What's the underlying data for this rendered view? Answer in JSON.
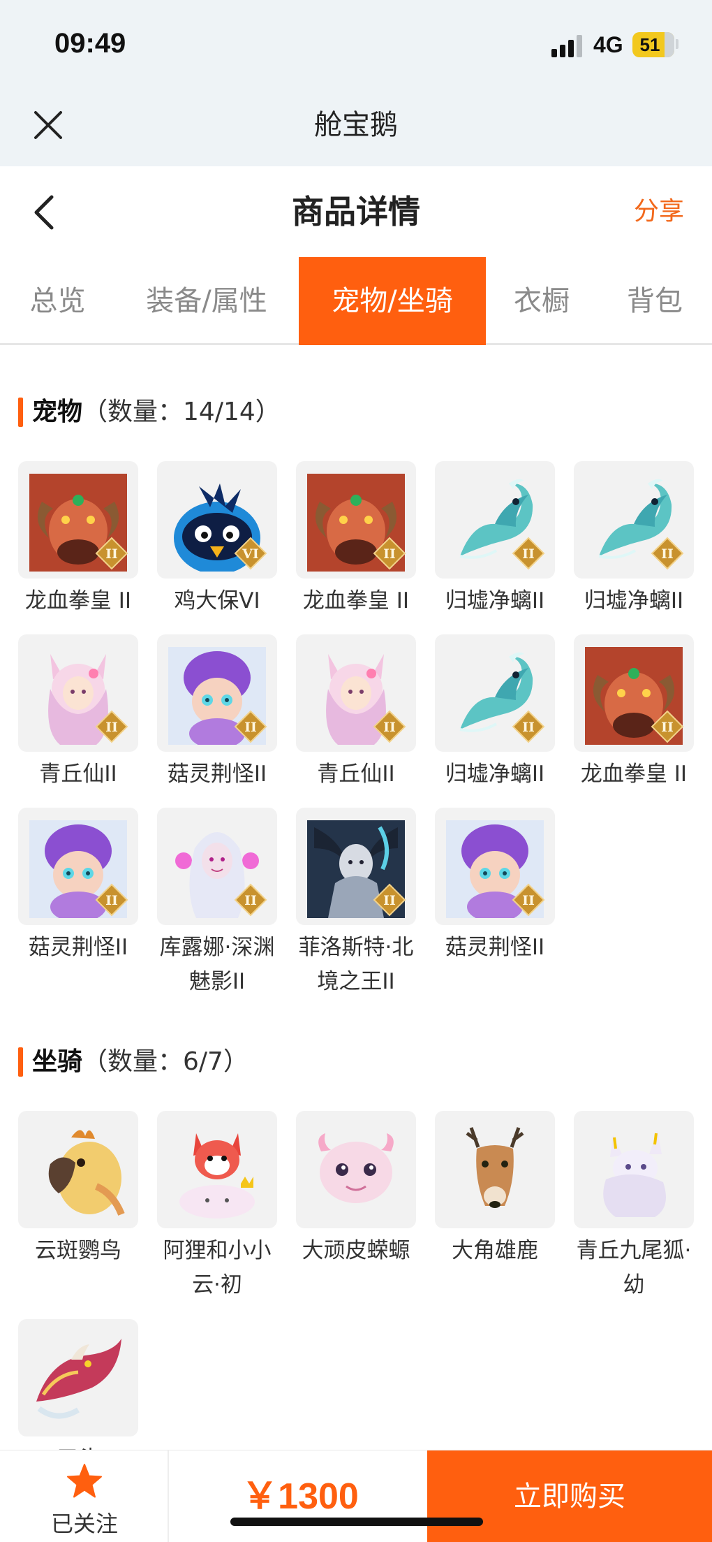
{
  "status_bar": {
    "time": "09:49",
    "network": "4G",
    "battery": "51"
  },
  "miniapp": {
    "title": "舱宝鹅"
  },
  "header": {
    "title": "商品详情",
    "share": "分享"
  },
  "tabs": [
    {
      "label": "总览",
      "active": false
    },
    {
      "label": "装备/属性",
      "active": false
    },
    {
      "label": "宠物/坐骑",
      "active": true
    },
    {
      "label": "衣橱",
      "active": false
    },
    {
      "label": "背包",
      "active": false
    }
  ],
  "pets": {
    "title": "宠物",
    "count_text": "（数量：14/14）",
    "items": [
      {
        "name": "龙血拳皇 II",
        "art": "dragon-fist",
        "badge": "II"
      },
      {
        "name": "鸡大保VI",
        "art": "blue-bird",
        "badge": "VI"
      },
      {
        "name": "龙血拳皇 II",
        "art": "dragon-fist",
        "badge": "II"
      },
      {
        "name": "归墟净螭II",
        "art": "sea-dragon",
        "badge": "II"
      },
      {
        "name": "归墟净螭II",
        "art": "sea-dragon",
        "badge": "II"
      },
      {
        "name": "青丘仙II",
        "art": "fox-fairy",
        "badge": "II"
      },
      {
        "name": "菇灵荆怪II",
        "art": "mushroom-sprite",
        "badge": "II"
      },
      {
        "name": "青丘仙II",
        "art": "fox-fairy",
        "badge": "II"
      },
      {
        "name": "归墟净螭II",
        "art": "sea-dragon",
        "badge": "II"
      },
      {
        "name": "龙血拳皇 II",
        "art": "dragon-fist",
        "badge": "II"
      },
      {
        "name": "菇灵荆怪II",
        "art": "mushroom-sprite",
        "badge": "II"
      },
      {
        "name": "库露娜·深渊魅影II",
        "art": "white-girl",
        "badge": "II"
      },
      {
        "name": "菲洛斯特·北境之王II",
        "art": "dark-knight",
        "badge": "II"
      },
      {
        "name": "菇灵荆怪II",
        "art": "mushroom-sprite",
        "badge": "II"
      }
    ]
  },
  "mounts": {
    "title": "坐骑",
    "count_text": "（数量：6/7）",
    "items": [
      {
        "name": "云斑鹦鸟",
        "art": "parrot"
      },
      {
        "name": "阿狸和小小云·初",
        "art": "red-fox-cloud"
      },
      {
        "name": "大顽皮蝾螈",
        "art": "axolotl"
      },
      {
        "name": "大角雄鹿",
        "art": "deer"
      },
      {
        "name": "青丘九尾狐·幼",
        "art": "white-fox"
      },
      {
        "name": "三头",
        "art": "red-dragon"
      }
    ]
  },
  "footer": {
    "follow_label": "已关注",
    "price": "￥1300",
    "buy_label": "立即购买"
  },
  "colors": {
    "accent": "#ff5f0f",
    "share": "#f2681b",
    "status_bg": "#eef3f6",
    "badge_gold": "#c8922e"
  }
}
